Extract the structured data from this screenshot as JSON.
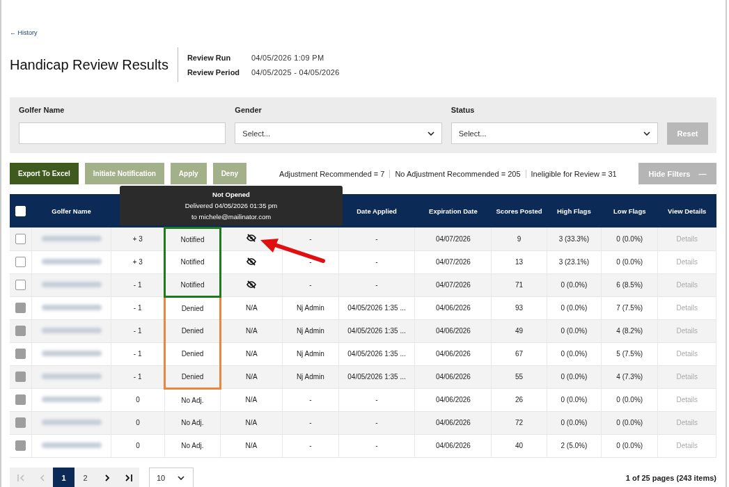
{
  "back_link": "← History",
  "title": "Handicap Review Results",
  "review_info": [
    {
      "label": "Review Run",
      "value": "04/05/2026  1:09 PM"
    },
    {
      "label": "Review Period",
      "value": "04/05/2025 - 04/05/2026"
    }
  ],
  "filters": {
    "fields": [
      {
        "kind": "text",
        "label": "Golfer Name"
      },
      {
        "kind": "select",
        "label": "Gender",
        "placeholder": "Select..."
      },
      {
        "kind": "select",
        "label": "Status",
        "placeholder": "Select..."
      }
    ],
    "reset_button": {
      "label": "Reset",
      "disabled": true
    }
  },
  "actions": [
    {
      "label": "Export To Excel",
      "disabled": false
    },
    {
      "label": "Initiate Notification",
      "disabled": true
    },
    {
      "label": "Apply",
      "disabled": true
    },
    {
      "label": "Deny",
      "disabled": true
    }
  ],
  "summary": [
    "Adjustment Recommended = 7",
    "No Adjustment Recommended = 205",
    "Ineligible for Review = 31"
  ],
  "hide_filters_button": {
    "label": "Hide Filters",
    "icon": "—"
  },
  "table": {
    "select_all_checked": false,
    "columns": [
      {
        "label": "Golfer Name"
      },
      {},
      {},
      {},
      {},
      {
        "label": "Date Applied"
      },
      {
        "label": "Expiration Date"
      },
      {
        "label": "Scores Posted"
      },
      {
        "label": "High Flags"
      },
      {
        "label": "Low Flags"
      },
      {
        "label": "View Details"
      }
    ],
    "rows": [
      {
        "checked": false,
        "disabled": false,
        "adjustment": "+ 3",
        "status": "Notified",
        "color": "#1f7a1f",
        "notification": {
          "kind": "not_opened"
        },
        "applied_by": "-",
        "date_applied": "-",
        "expiration": "04/07/2026",
        "scores": "9",
        "high": "3 (33.3%)",
        "low": "0 (0.0%)",
        "details": "Details"
      },
      {
        "checked": false,
        "disabled": false,
        "adjustment": "+ 3",
        "status": "Notified",
        "color": "#1f7a1f",
        "notification": {
          "kind": "not_opened"
        },
        "applied_by": "-",
        "date_applied": "-",
        "expiration": "04/07/2026",
        "scores": "13",
        "high": "3 (23.1%)",
        "low": "0 (0.0%)",
        "details": "Details"
      },
      {
        "checked": false,
        "disabled": false,
        "adjustment": "- 1",
        "status": "Notified",
        "color": "#1f7a1f",
        "notification": {
          "kind": "not_opened"
        },
        "applied_by": "-",
        "date_applied": "-",
        "expiration": "04/07/2026",
        "scores": "71",
        "high": "0 (0.0%)",
        "low": "6 (8.5%)",
        "details": "Details"
      },
      {
        "checked": false,
        "disabled": true,
        "adjustment": "- 1",
        "status": "Denied",
        "color": "#f0843c",
        "notification": {
          "kind": "text",
          "text": "N/A"
        },
        "applied_by": "Nj Admin",
        "date_applied": "04/05/2026 1:35 ...",
        "expiration": "04/06/2026",
        "scores": "93",
        "high": "0 (0.0%)",
        "low": "7 (7.5%)",
        "details": "Details"
      },
      {
        "checked": false,
        "disabled": true,
        "adjustment": "- 1",
        "status": "Denied",
        "color": "#f0843c",
        "notification": {
          "kind": "text",
          "text": "N/A"
        },
        "applied_by": "Nj Admin",
        "date_applied": "04/05/2026 1:35 ...",
        "expiration": "04/06/2026",
        "scores": "49",
        "high": "0 (0.0%)",
        "low": "4 (8.2%)",
        "details": "Details"
      },
      {
        "checked": false,
        "disabled": true,
        "adjustment": "- 1",
        "status": "Denied",
        "color": "#f0843c",
        "notification": {
          "kind": "text",
          "text": "N/A"
        },
        "applied_by": "Nj Admin",
        "date_applied": "04/05/2026 1:35 ...",
        "expiration": "04/06/2026",
        "scores": "67",
        "high": "0 (0.0%)",
        "low": "5 (7.5%)",
        "details": "Details"
      },
      {
        "checked": false,
        "disabled": true,
        "adjustment": "- 1",
        "status": "Denied",
        "color": "#f0843c",
        "notification": {
          "kind": "text",
          "text": "N/A"
        },
        "applied_by": "Nj Admin",
        "date_applied": "04/05/2026 1:35 ...",
        "expiration": "04/06/2026",
        "scores": "55",
        "high": "0 (0.0%)",
        "low": "4 (7.3%)",
        "details": "Details"
      },
      {
        "checked": false,
        "disabled": true,
        "adjustment": "0",
        "status": "No Adj.",
        "notification": {
          "kind": "text",
          "text": "N/A"
        },
        "applied_by": "-",
        "date_applied": "-",
        "expiration": "04/06/2026",
        "scores": "26",
        "high": "0 (0.0%)",
        "low": "0 (0.0%)",
        "details": "Details"
      },
      {
        "checked": false,
        "disabled": true,
        "adjustment": "0",
        "status": "No Adj.",
        "notification": {
          "kind": "text",
          "text": "N/A"
        },
        "applied_by": "-",
        "date_applied": "-",
        "expiration": "04/06/2026",
        "scores": "72",
        "high": "0 (0.0%)",
        "low": "0 (0.0%)",
        "details": "Details"
      },
      {
        "checked": false,
        "disabled": true,
        "adjustment": "0",
        "status": "No Adj.",
        "notification": {
          "kind": "text",
          "text": "N/A"
        },
        "applied_by": "-",
        "date_applied": "-",
        "expiration": "04/06/2026",
        "scores": "40",
        "high": "2 (5.0%)",
        "low": "0 (0.0%)",
        "details": "Details"
      }
    ]
  },
  "tooltip": {
    "title": "Not Opened",
    "lines": [
      "Delivered 04/05/2026 01:35 pm",
      "to michele@mailinator.com"
    ]
  },
  "pagination": {
    "pages": [
      {
        "label": "1",
        "selected": true
      },
      {
        "label": "2",
        "selected": false
      }
    ],
    "page_size": "10",
    "summary": "1 of 25 pages (243 items)"
  }
}
